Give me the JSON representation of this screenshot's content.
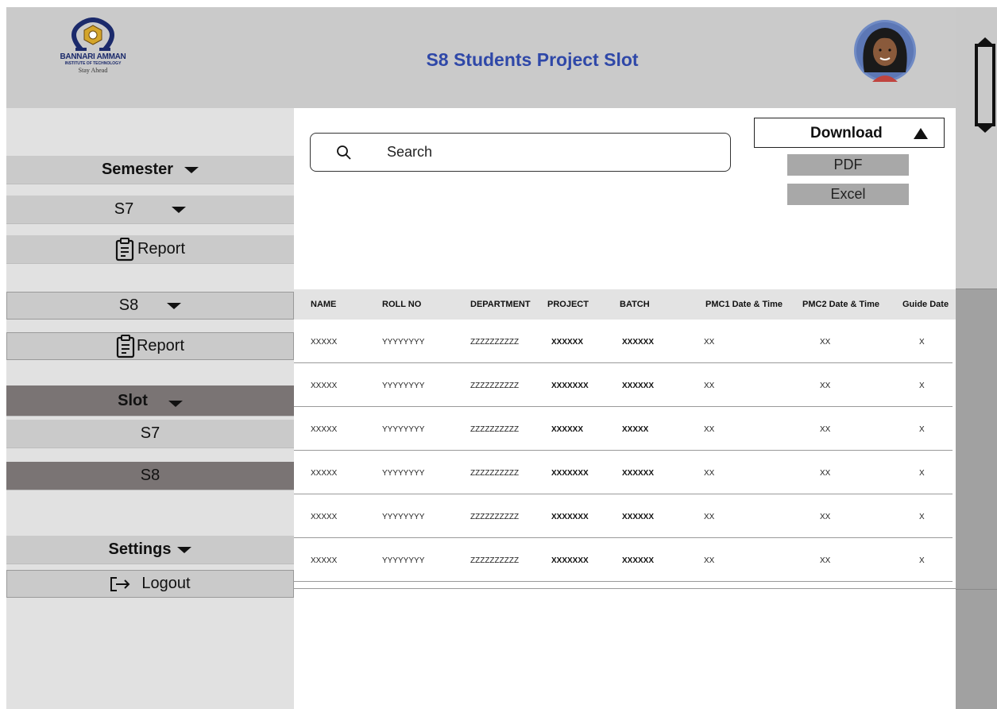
{
  "header": {
    "logo_name": "BANNARI AMMAN",
    "logo_sub": "INSTITUTE OF TECHNOLOGY",
    "logo_tagline": "Stay Ahead",
    "title": "S8 Students Project Slot"
  },
  "sidebar": {
    "semester": "Semester",
    "s7": "S7",
    "report1": "Report",
    "s8": "S8",
    "report2": "Report",
    "slot": "Slot",
    "slot_s7": "S7",
    "slot_s8": "S8",
    "settings": "Settings",
    "logout": "Logout"
  },
  "search": {
    "label": "Search"
  },
  "download": {
    "label": "Download",
    "options": [
      "PDF",
      "Excel"
    ]
  },
  "table": {
    "headers": [
      "NAME",
      "ROLL NO",
      "DEPARTMENT",
      "PROJECT",
      "BATCH",
      "PMC1 Date & Time",
      "PMC2 Date & Time",
      "Guide Date"
    ],
    "rows": [
      [
        "XXXXX",
        "YYYYYYYY",
        "ZZZZZZZZZZ",
        "XXXXXX",
        "XXXXXX",
        "XX",
        "XX",
        "X"
      ],
      [
        "XXXXX",
        "YYYYYYYY",
        "ZZZZZZZZZZ",
        "XXXXXXX",
        "XXXXXX",
        "XX",
        "XX",
        "X"
      ],
      [
        "XXXXX",
        "YYYYYYYY",
        "ZZZZZZZZZZ",
        "XXXXXX",
        "XXXXX",
        "XX",
        "XX",
        "X"
      ],
      [
        "XXXXX",
        "YYYYYYYY",
        "ZZZZZZZZZZ",
        "XXXXXXX",
        "XXXXXX",
        "XX",
        "XX",
        "X"
      ],
      [
        "XXXXX",
        "YYYYYYYY",
        "ZZZZZZZZZZ",
        "XXXXXXX",
        "XXXXXX",
        "XX",
        "XX",
        "X"
      ],
      [
        "XXXXX",
        "YYYYYYYY",
        "ZZZZZZZZZZ",
        "XXXXXXX",
        "XXXXXX",
        "XX",
        "XX",
        "X"
      ]
    ]
  }
}
